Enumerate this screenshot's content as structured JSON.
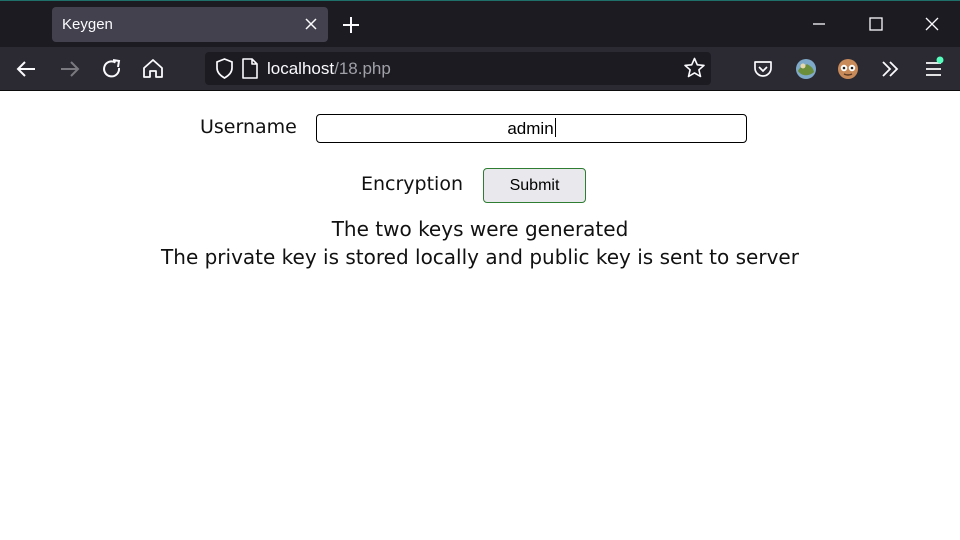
{
  "browser": {
    "tab_title": "Keygen",
    "url_host": "localhost",
    "url_path": "/18.php"
  },
  "form": {
    "username_label": "Username",
    "username_value": "admin",
    "encryption_label": "Encryption",
    "submit_label": "Submit"
  },
  "messages": {
    "line1": "The two keys were generated",
    "line2": "The private key is stored locally and public key is sent to server"
  },
  "colors": {
    "tabstrip": "#1c1b22",
    "toolbar": "#2b2a33",
    "active_tab": "#42414d",
    "notification_dot": "#54ffbd"
  }
}
